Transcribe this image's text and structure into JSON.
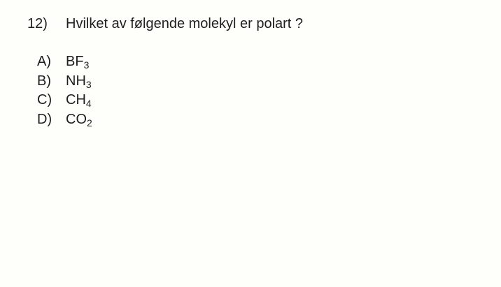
{
  "question": {
    "number": "12)",
    "text": "Hvilket av følgende molekyl er polart ?"
  },
  "options": [
    {
      "letter": "A)",
      "base": "BF",
      "subscript": "3"
    },
    {
      "letter": "B)",
      "base": "NH",
      "subscript": "3"
    },
    {
      "letter": "C)",
      "base": "CH",
      "subscript": "4"
    },
    {
      "letter": "D)",
      "base": "CO",
      "subscript": "2"
    }
  ]
}
